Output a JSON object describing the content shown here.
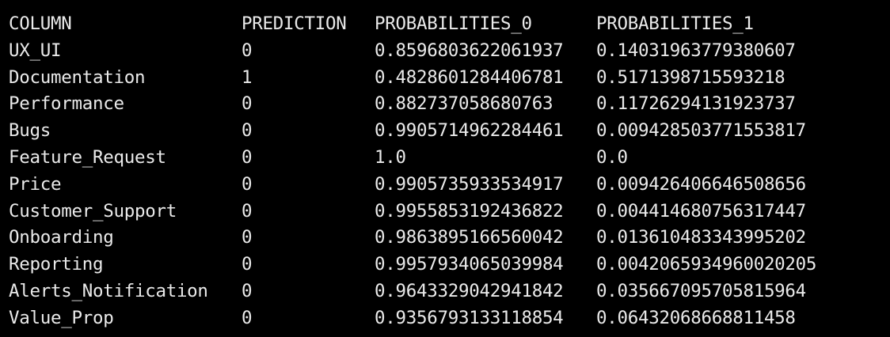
{
  "headers": [
    "COLUMN",
    "PREDICTION",
    "PROBABILITIES_0",
    "PROBABILITIES_1"
  ],
  "rows": [
    [
      "UX_UI",
      "0",
      "0.8596803622061937",
      "0.14031963779380607"
    ],
    [
      "Documentation",
      "1",
      "0.4828601284406781",
      "0.5171398715593218"
    ],
    [
      "Performance",
      "0",
      "0.882737058680763",
      "0.11726294131923737"
    ],
    [
      "Bugs",
      "0",
      "0.9905714962284461",
      "0.009428503771553817"
    ],
    [
      "Feature_Request",
      "0",
      "1.0",
      "0.0"
    ],
    [
      "Price",
      "0",
      "0.9905735933534917",
      "0.009426406646508656"
    ],
    [
      "Customer_Support",
      "0",
      "0.9955853192436822",
      "0.004414680756317447"
    ],
    [
      "Onboarding",
      "0",
      "0.9863895166560042",
      "0.013610483343995202"
    ],
    [
      "Reporting",
      "0",
      "0.9957934065039984",
      "0.0042065934960020205"
    ],
    [
      "Alerts_Notification",
      "0",
      "0.9643329042941842",
      "0.035667095705815964"
    ],
    [
      "Value_Prop",
      "0",
      "0.9356793133118854",
      "0.06432068668811458"
    ]
  ]
}
